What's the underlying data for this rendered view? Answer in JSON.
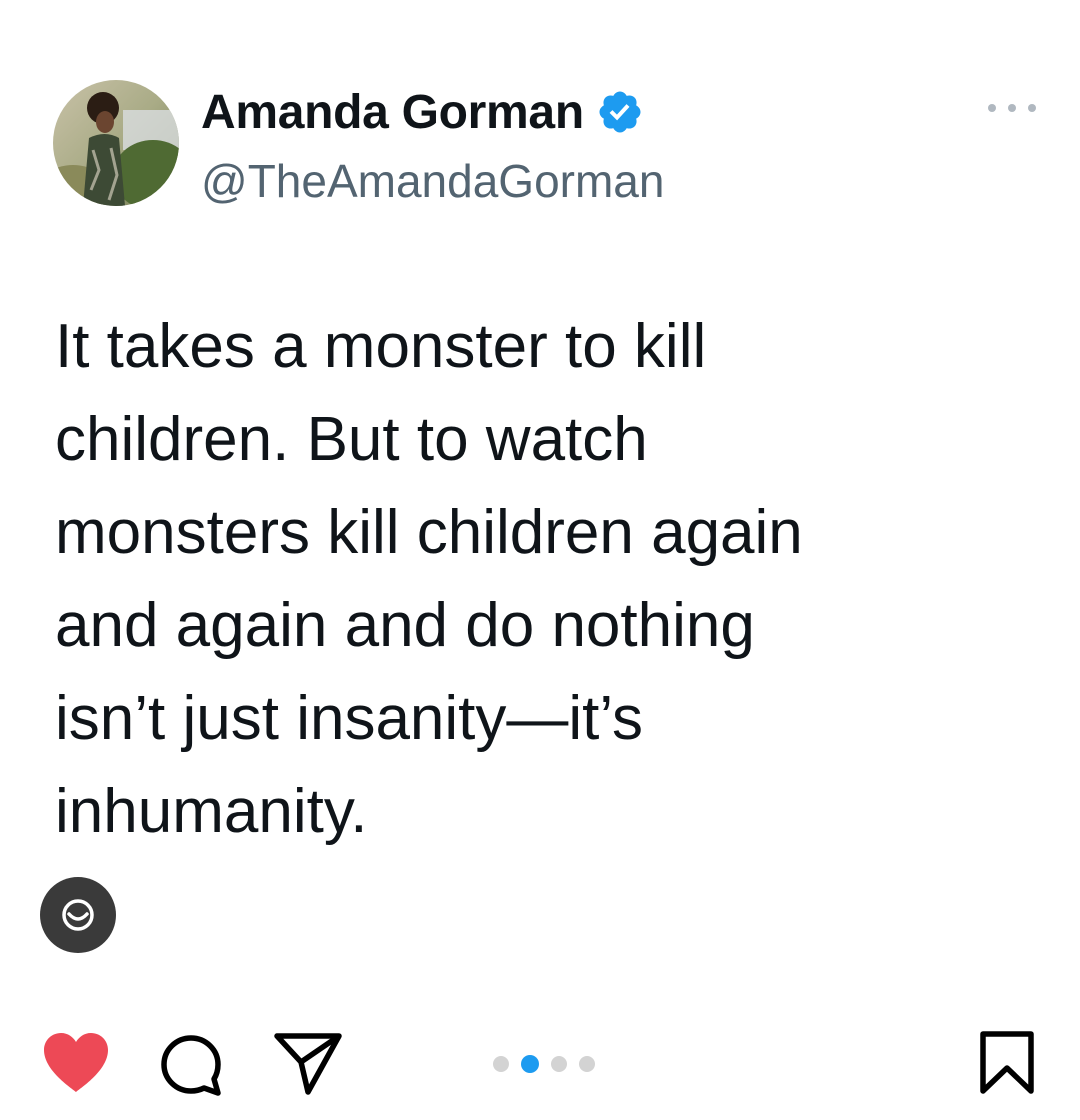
{
  "tweet": {
    "display_name": "Amanda Gorman",
    "handle": "@TheAmandaGorman",
    "verified": true,
    "verified_color": "#1d9bf0",
    "text_lines": [
      "It takes a monster to kill",
      "children. But to watch",
      "monsters kill children again",
      "and again and do nothing",
      "isn’t just insanity—it’s",
      "inhumanity."
    ],
    "more_icon": "ellipsis-icon"
  },
  "media_badge": {
    "icon": "threads-icon"
  },
  "actions": {
    "like": {
      "icon": "heart-icon",
      "liked": true,
      "color": "#ed4956"
    },
    "comment": {
      "icon": "comment-icon"
    },
    "share": {
      "icon": "paper-plane-icon"
    },
    "save": {
      "icon": "bookmark-icon"
    }
  },
  "carousel": {
    "total": 4,
    "active_index": 1,
    "active_color": "#1d9bf0"
  }
}
